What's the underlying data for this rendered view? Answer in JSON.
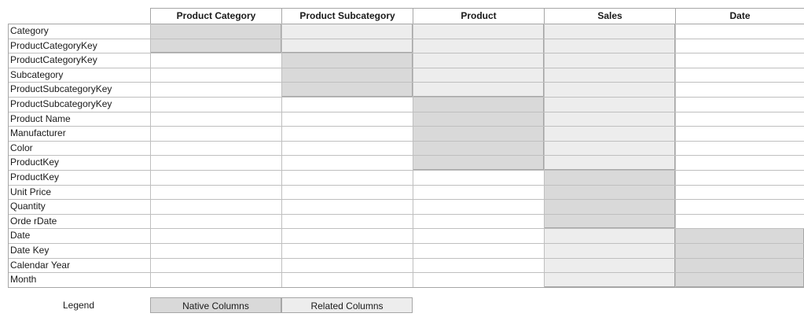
{
  "columns": [
    "Product Category",
    "Product Subcategory",
    "Product",
    "Sales",
    "Date"
  ],
  "rows": [
    "Category",
    "ProductCategoryKey",
    "ProductCategoryKey",
    "Subcategory",
    "ProductSubcategoryKey",
    "ProductSubcategoryKey",
    "Product Name",
    "Manufacturer",
    "Color",
    "ProductKey",
    "ProductKey",
    "Unit Price",
    "Quantity",
    "Orde rDate",
    "Date",
    "Date Key",
    "Calendar Year",
    "Month"
  ],
  "blocks": [
    {
      "column": 0,
      "kind": "native",
      "row_start": 0,
      "row_end": 1
    },
    {
      "column": 1,
      "kind": "related",
      "row_start": 0,
      "row_end": 1
    },
    {
      "column": 1,
      "kind": "native",
      "row_start": 2,
      "row_end": 4
    },
    {
      "column": 2,
      "kind": "related",
      "row_start": 0,
      "row_end": 4
    },
    {
      "column": 2,
      "kind": "native",
      "row_start": 5,
      "row_end": 9
    },
    {
      "column": 3,
      "kind": "related",
      "row_start": 0,
      "row_end": 9
    },
    {
      "column": 3,
      "kind": "native",
      "row_start": 10,
      "row_end": 13
    },
    {
      "column": 3,
      "kind": "related",
      "row_start": 14,
      "row_end": 17
    },
    {
      "column": 4,
      "kind": "native",
      "row_start": 14,
      "row_end": 17
    }
  ],
  "colors": {
    "native": "#d9d9d9",
    "related": "#ededed",
    "grid_line": "#bfbfbf",
    "border": "#a6a6a6"
  },
  "legend": {
    "label": "Legend",
    "native_label": "Native Columns",
    "related_label": "Related Columns"
  }
}
